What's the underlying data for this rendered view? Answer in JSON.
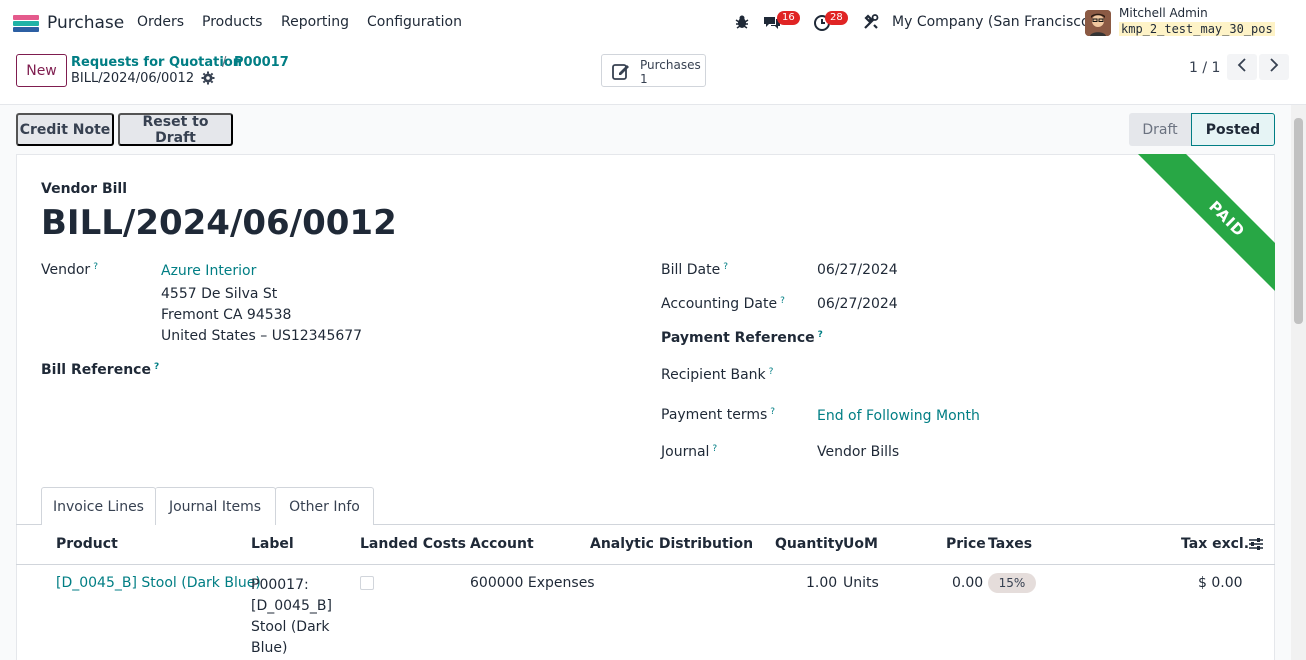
{
  "navbar": {
    "app_name": "Purchase",
    "menus": [
      "Orders",
      "Products",
      "Reporting",
      "Configuration"
    ],
    "messages_count": "16",
    "activities_count": "28",
    "company": "My Company (San Francisco)",
    "user_name": "Mitchell Admin",
    "database": "kmp_2_test_may_30_pos"
  },
  "control": {
    "new_label": "New",
    "breadcrumb_1": "Requests for Quotation",
    "breadcrumb_sep": "/",
    "breadcrumb_2": "P00017",
    "current": "BILL/2024/06/0012",
    "smart_button": {
      "label": "Purchases",
      "count": "1"
    },
    "pager": "1 / 1"
  },
  "actions": {
    "credit_note": "Credit Note",
    "reset_to_draft": "Reset to Draft"
  },
  "status": {
    "draft": "Draft",
    "posted": "Posted"
  },
  "sheet": {
    "ribbon": "PAID",
    "doc_type": "Vendor Bill",
    "doc_title": "BILL/2024/06/0012",
    "vendor_label": "Vendor",
    "vendor_name": "Azure Interior",
    "vendor_street": "4557 De Silva St",
    "vendor_city": "Fremont CA 94538",
    "vendor_country": "United States – US12345677",
    "bill_reference_label": "Bill Reference",
    "bill_date_label": "Bill Date",
    "bill_date": "06/27/2024",
    "accounting_date_label": "Accounting Date",
    "accounting_date": "06/27/2024",
    "payment_reference_label": "Payment Reference",
    "recipient_bank_label": "Recipient Bank",
    "payment_terms_label": "Payment terms",
    "payment_terms": "End of Following Month",
    "journal_label": "Journal",
    "journal": "Vendor Bills",
    "help_mark": "?"
  },
  "tabs": [
    "Invoice Lines",
    "Journal Items",
    "Other Info"
  ],
  "table": {
    "headers": [
      "Product",
      "Label",
      "Landed Costs",
      "Account",
      "Analytic Distribution",
      "Quantity",
      "UoM",
      "Price",
      "Taxes",
      "Tax excl."
    ],
    "rows": [
      {
        "product": "[D_0045_B] Stool (Dark Blue)",
        "label_lines": [
          "P00017:",
          "[D_0045_B]",
          "Stool (Dark",
          "Blue)"
        ],
        "account": "600000 Expenses",
        "quantity": "1.00",
        "uom": "Units",
        "price": "0.00",
        "taxes": "15%",
        "tax_excl": "$ 0.00"
      }
    ]
  },
  "colors": {
    "accent": "#017e84",
    "brand": "#7f1d4f",
    "paid_ribbon": "#28a745",
    "badge": "#e02424"
  }
}
